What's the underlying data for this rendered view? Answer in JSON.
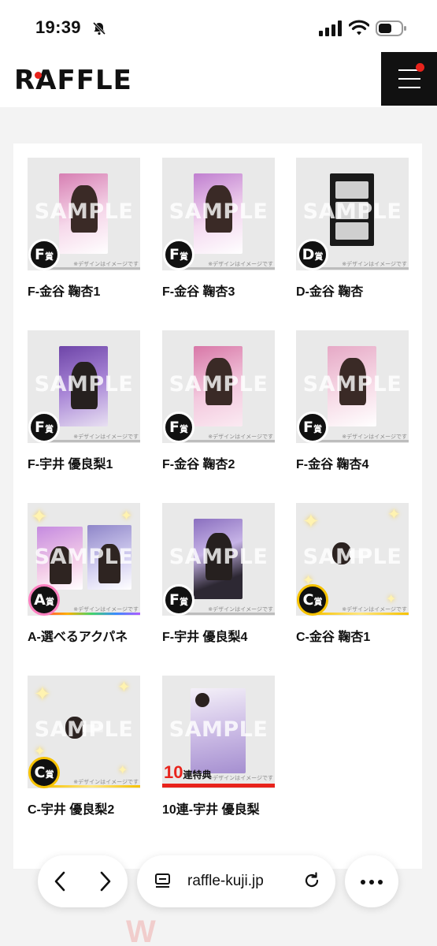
{
  "status": {
    "time": "19:39"
  },
  "header": {
    "logo": "RAFFLE"
  },
  "watermark": "SAMPLE",
  "disclaimer": "※デザインはイメージです",
  "items": [
    {
      "rank": "F",
      "suffix": "賞",
      "label": "F-金谷 鞠杏1"
    },
    {
      "rank": "F",
      "suffix": "賞",
      "label": "F-金谷 鞠杏3"
    },
    {
      "rank": "D",
      "suffix": "賞",
      "label": "D-金谷 鞠杏"
    },
    {
      "rank": "F",
      "suffix": "賞",
      "label": "F-宇井 優良梨1"
    },
    {
      "rank": "F",
      "suffix": "賞",
      "label": "F-金谷 鞠杏2"
    },
    {
      "rank": "F",
      "suffix": "賞",
      "label": "F-金谷 鞠杏4"
    },
    {
      "rank": "A",
      "suffix": "賞",
      "label": "A-選べるアクパネ"
    },
    {
      "rank": "F",
      "suffix": "賞",
      "label": "F-宇井 優良梨4"
    },
    {
      "rank": "C",
      "suffix": "賞",
      "label": "C-金谷 鞠杏1"
    },
    {
      "rank": "C",
      "suffix": "賞",
      "label": "C-宇井 優良梨2"
    },
    {
      "rank": "10",
      "suffix": "連特典",
      "label": "10連-宇井 優良梨"
    }
  ],
  "browser": {
    "url": "raffle-kuji.jp"
  },
  "colors": {
    "accent": "#e8231c",
    "header_dark": "#111111",
    "a_rank_gradient": "rainbow",
    "c_rank_gradient": "gold"
  }
}
